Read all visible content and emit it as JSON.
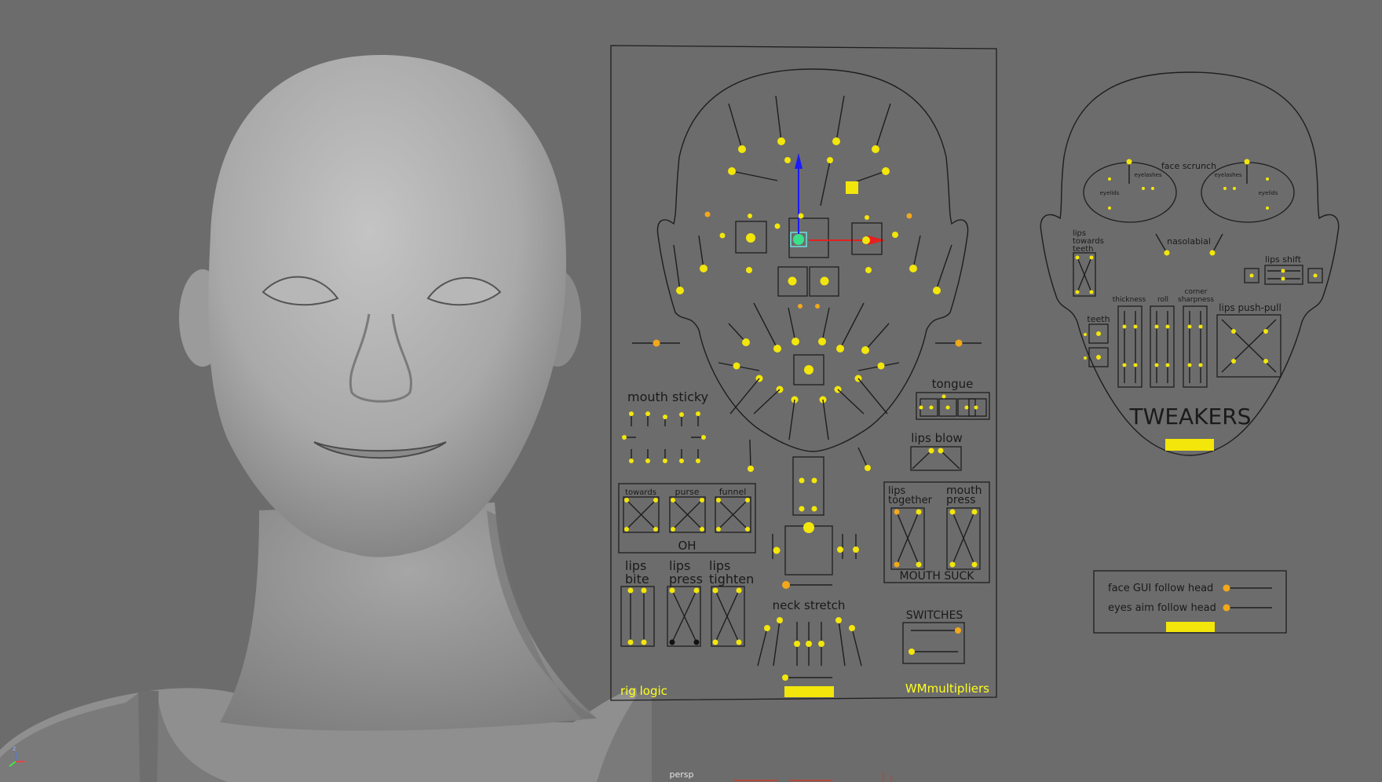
{
  "viewport": {
    "camera_label": "persp"
  },
  "axis_gizmo": {
    "z": "z",
    "y": "y",
    "x": "x"
  },
  "main_panel": {
    "mouth_sticky": "mouth sticky",
    "oh": {
      "towards": "towards",
      "purse": "purse",
      "funnel": "funnel",
      "title": "OH"
    },
    "lips_bite": [
      "lips",
      "bite"
    ],
    "lips_press": [
      "lips",
      "press"
    ],
    "lips_tighten": [
      "lips",
      "tighten"
    ],
    "tongue": "tongue",
    "lips_blow": "lips blow",
    "lips_together": [
      "lips",
      "together"
    ],
    "mouth_press": [
      "mouth",
      "press"
    ],
    "mouth_suck": "MOUTH SUCK",
    "neck_stretch": "neck stretch",
    "switches": "SWITCHES",
    "rig_logic": "rig logic",
    "wm_multipliers": "WMmultipliers"
  },
  "tweakers_panel": {
    "face_scrunch": "face scrunch",
    "eyelashes_left": "eyelashes",
    "eyelashes_right": "eyelashes",
    "eyelids_left": "eyelids",
    "eyelids_right": "eyelids",
    "lips_towards_teeth": [
      "lips",
      "towards",
      "teeth"
    ],
    "nasolabial": "nasolabial",
    "lips_shift": "lips shift",
    "teeth": "teeth",
    "thickness": "thickness",
    "roll": "roll",
    "corner_sharpness": [
      "corner",
      "sharpness"
    ],
    "lips_push_pull": "lips push-pull",
    "title": "TWEAKERS"
  },
  "follow_panel": {
    "face_gui_follow_head": "face GUI follow head",
    "eyes_aim_follow_head": "eyes aim follow head"
  },
  "colors": {
    "background": "#6c6c6c",
    "control_yellow": "#f3e60a",
    "control_orange": "#f2a81a",
    "label_yellow": "#ffff1e",
    "selected_green": "#3be08a"
  }
}
